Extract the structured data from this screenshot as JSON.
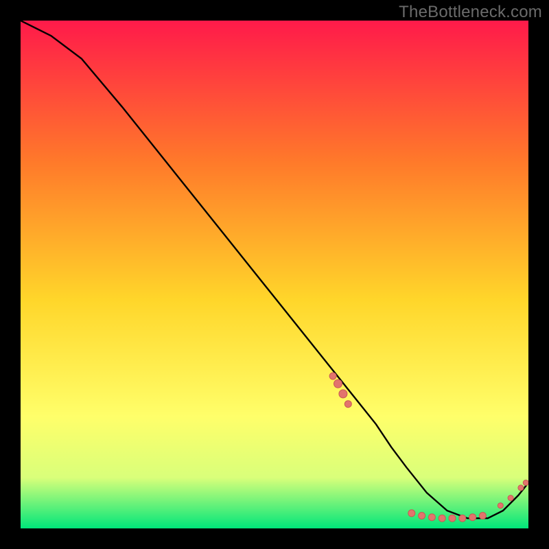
{
  "watermark": "TheBottleneck.com",
  "colors": {
    "page_bg": "#000000",
    "gradient_top": "#ff1a4a",
    "gradient_mid_upper": "#ff7a2a",
    "gradient_mid": "#ffd62a",
    "gradient_mid_lower": "#ffff6a",
    "gradient_lower": "#d9ff7a",
    "gradient_bottom": "#00e67a",
    "curve": "#000000",
    "marker_fill": "#e2746d",
    "marker_stroke": "#c95a53"
  },
  "chart_data": {
    "type": "line",
    "title": "",
    "xlabel": "",
    "ylabel": "",
    "xlim": [
      0,
      100
    ],
    "ylim": [
      0,
      100
    ],
    "grid": false,
    "legend": false,
    "series": [
      {
        "name": "bottleneck-curve",
        "x": [
          0,
          6,
          12,
          20,
          30,
          40,
          50,
          58,
          62,
          66,
          70,
          73,
          76,
          80,
          84,
          88,
          92,
          95,
          98,
          100
        ],
        "y": [
          100,
          97,
          92.5,
          83,
          70.5,
          58,
          45.5,
          35.5,
          30.5,
          25.5,
          20.5,
          16,
          12,
          7,
          3.5,
          2,
          2,
          3.5,
          6.5,
          9
        ]
      }
    ],
    "markers": [
      {
        "name": "cluster-left-1",
        "x": 61.5,
        "y": 30.0,
        "r": 5
      },
      {
        "name": "cluster-left-2",
        "x": 62.5,
        "y": 28.5,
        "r": 6
      },
      {
        "name": "cluster-left-3",
        "x": 63.5,
        "y": 26.5,
        "r": 6
      },
      {
        "name": "cluster-left-4",
        "x": 64.5,
        "y": 24.5,
        "r": 5
      },
      {
        "name": "floor-1",
        "x": 77.0,
        "y": 3.0,
        "r": 5
      },
      {
        "name": "floor-2",
        "x": 79.0,
        "y": 2.5,
        "r": 5
      },
      {
        "name": "floor-3",
        "x": 81.0,
        "y": 2.2,
        "r": 5
      },
      {
        "name": "floor-4",
        "x": 83.0,
        "y": 2.0,
        "r": 5
      },
      {
        "name": "floor-5",
        "x": 85.0,
        "y": 2.0,
        "r": 5
      },
      {
        "name": "floor-6",
        "x": 87.0,
        "y": 2.0,
        "r": 5
      },
      {
        "name": "floor-7",
        "x": 89.0,
        "y": 2.2,
        "r": 5
      },
      {
        "name": "floor-8",
        "x": 91.0,
        "y": 2.5,
        "r": 5
      },
      {
        "name": "rise-1",
        "x": 94.5,
        "y": 4.5,
        "r": 4
      },
      {
        "name": "rise-2",
        "x": 96.5,
        "y": 6.0,
        "r": 4
      },
      {
        "name": "rise-3",
        "x": 98.5,
        "y": 8.0,
        "r": 4
      },
      {
        "name": "rise-4",
        "x": 99.5,
        "y": 9.0,
        "r": 4
      }
    ]
  }
}
